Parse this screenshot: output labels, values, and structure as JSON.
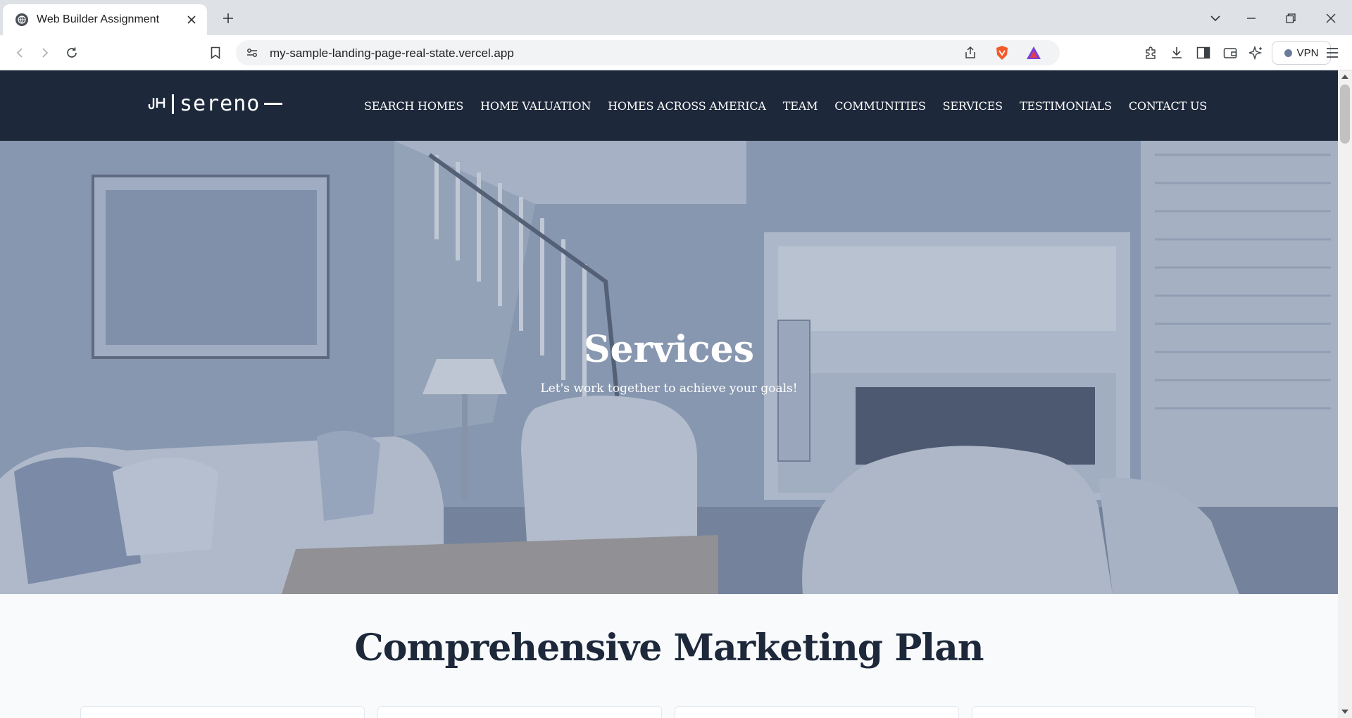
{
  "browser": {
    "tab_title": "Web Builder Assignment",
    "url": "my-sample-landing-page-real-state.vercel.app",
    "vpn_label": "VPN"
  },
  "site": {
    "logo_mark": "J-H",
    "logo_word": "sereno",
    "nav": [
      {
        "label": "SEARCH HOMES"
      },
      {
        "label": "HOME VALUATION"
      },
      {
        "label": "HOMES ACROSS AMERICA"
      },
      {
        "label": "TEAM"
      },
      {
        "label": "COMMUNITIES"
      },
      {
        "label": "SERVICES"
      },
      {
        "label": "TESTIMONIALS"
      },
      {
        "label": "CONTACT US"
      }
    ]
  },
  "hero": {
    "title": "Services",
    "subtitle": "Let's work together to achieve your goals!"
  },
  "section": {
    "title": "Comprehensive Marketing Plan"
  },
  "colors": {
    "header_bg": "#1d283a",
    "page_bg": "#f8fafc"
  }
}
